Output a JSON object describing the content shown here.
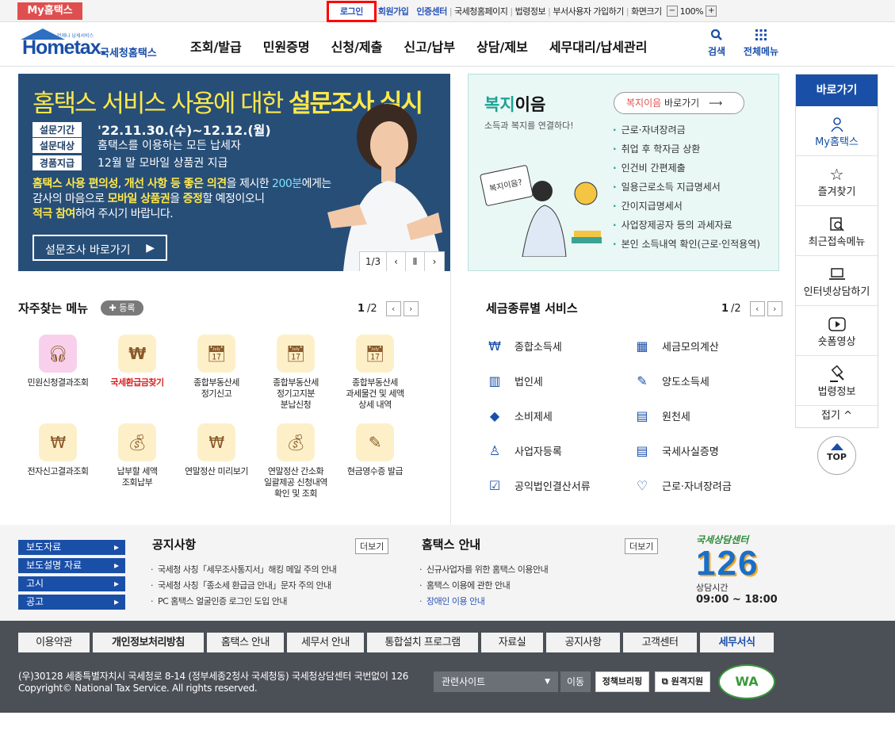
{
  "topbar": {
    "myhometax": "My홈택스",
    "login": "로그인",
    "links": [
      "회원가입",
      "인증센터",
      "국세청홈페이지",
      "법령정보",
      "부서사용자 가입하기",
      "화면크기"
    ],
    "zoom": "100%",
    "zoom_minus": "−",
    "zoom_plus": "+"
  },
  "header": {
    "logo_text": "Hometax.",
    "logo_small": "언제나 납세서비스",
    "logo_kr": "국세청홈택스",
    "nav": [
      "조회/발급",
      "민원증명",
      "신청/제출",
      "신고/납부",
      "상담/제보",
      "세무대리/납세관리"
    ],
    "search": "검색",
    "allmenu": "전체메뉴"
  },
  "banner": {
    "title_normal": "홈택스 서비스 사용에 대한 ",
    "title_bold": "설문조사 실시",
    "rows": [
      {
        "label": "설문기간",
        "value": "'22.11.30.(수)~12.12.(월)"
      },
      {
        "label": "설문대상",
        "value": "홈택스를 이용하는 모든 납세자"
      },
      {
        "label": "경품지급",
        "value": "12월 말 모바일 상품권 지급"
      }
    ],
    "desc1_a": "홈택스 사용 편의성",
    "desc1_b": ", ",
    "desc1_c": "개선 사항 등 좋은 의견",
    "desc1_d": "을 제시한 ",
    "desc1_e": "200분",
    "desc1_f": "에게는",
    "desc2_a": "감사의 마음으로 ",
    "desc2_b": "모바일 상품권",
    "desc2_c": "을 ",
    "desc2_d": "증정",
    "desc2_e": "할 예정이오니",
    "desc3_a": "적극 참여",
    "desc3_b": "하여 주시기 바랍니다.",
    "button": "설문조사 바로가기",
    "page": "1/3"
  },
  "welfare": {
    "title_color": "복지",
    "title_black": "이음",
    "subtitle": "소득과 복지를 연결하다!",
    "btn_red": "복지이음",
    "btn_rest": " 바로가기",
    "bubble": "복지이음?",
    "items": [
      "근로·자녀장려금",
      "취업 후 학자금 상환",
      "인건비 간편제출",
      "일용근로소득 지급명세서",
      "간이지급명세서",
      "사업장제공자 등의 과세자료",
      "본인 소득내역 확인(근로·인적용역)"
    ]
  },
  "quick": {
    "title": "바로가기",
    "items": [
      "My홈택스",
      "즐겨찾기",
      "최근접속메뉴",
      "인터넷상담하기",
      "숏폼영상",
      "법령정보"
    ],
    "fold": "접기",
    "top": "TOP"
  },
  "favorites": {
    "title": "자주찾는 메뉴",
    "add": "등록",
    "page_cur": "1",
    "page_total": "/2",
    "items": [
      {
        "label": "민원신청결과조회"
      },
      {
        "label": "국세환급금찾기"
      },
      {
        "label": "종합부동산세\n정기신고"
      },
      {
        "label": "종합부동산세\n정기고지분\n분납신청"
      },
      {
        "label": "종합부동산세\n과세물건 및 세액\n상세 내역"
      },
      {
        "label": "전자신고결과조회"
      },
      {
        "label": "납부할 세액\n조회납부"
      },
      {
        "label": "연말정산 미리보기"
      },
      {
        "label": "연말정산 간소화\n일괄제공 신청내역\n확인 및 조회"
      },
      {
        "label": "현금영수증 발급"
      }
    ]
  },
  "tax": {
    "title": "세금종류별 서비스",
    "page_cur": "1",
    "page_total": "/2",
    "left": [
      "종합소득세",
      "법인세",
      "소비제세",
      "사업자등록",
      "공익법인결산서류"
    ],
    "right": [
      "세금모의계산",
      "양도소득세",
      "원천세",
      "국세사실증명",
      "근로·자녀장려금"
    ]
  },
  "bottom": {
    "side": [
      "보도자료",
      "보도설명 자료",
      "고시",
      "공고"
    ],
    "notice_title": "공지사항",
    "notice_more": "더보기",
    "notices": [
      "국세청 사칭「세무조사통지서」해킹 메일 주의 안내",
      "국세청 사칭「종소세 환급금 안내」문자 주의 안내",
      "PC 홈택스 얼굴인증 로그인 도입 안내"
    ],
    "guide_title": "홈택스 안내",
    "guide_more": "더보기",
    "guides": [
      "신규사업자를 위한 홈택스 이용안내",
      "홈택스 이용에 관한 안내",
      "장애인 이용 안내"
    ],
    "call_title": "국세상담센터",
    "call_number": "126",
    "call_hours_label": "상담시간",
    "call_hours": "09:00 ~ 18:00"
  },
  "footer": {
    "nav": [
      "이용약관",
      "개인정보처리방침",
      "홈택스 안내",
      "세무서 안내",
      "통합설치 프로그램",
      "자료실",
      "공지사항",
      "고객센터",
      "세무서식"
    ],
    "addr1": "(우)30128 세종특별자치시 국세청로 8-14 (정부세종2청사 국세청동) 국세청상담센터 국번없이 126",
    "addr2": "Copyright© National Tax Service. All rights reserved.",
    "related": "관련사이트",
    "move": "이동",
    "policy": "정책브리핑",
    "remote": "원격지원",
    "wa": "WA"
  }
}
